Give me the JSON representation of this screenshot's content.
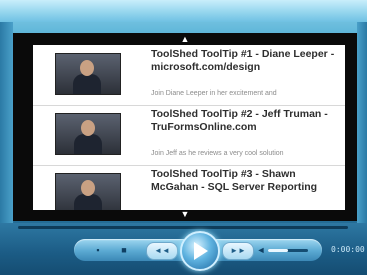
{
  "playlist": {
    "scroll_up_glyph": "▲",
    "scroll_down_glyph": "▼",
    "items": [
      {
        "title": "ToolShed ToolTip #1 - Diane Leeper - microsoft.com/design",
        "description": "Join Diane Leeper in her excitement and",
        "thumbnail_icon": "video-thumbnail"
      },
      {
        "title": "ToolShed ToolTip #2 - Jeff Truman - TruFormsOnline.com",
        "description": "Join Jeff as he reviews a very cool solution",
        "thumbnail_icon": "video-thumbnail"
      },
      {
        "title": "ToolShed ToolTip #3 - Shawn McGahan - SQL Server Reporting",
        "description": "",
        "thumbnail_icon": "video-thumbnail"
      }
    ]
  },
  "controls": {
    "stop_glyph": "■",
    "prev_label": "◄◄",
    "play_icon": "play-icon",
    "next_label": "►►",
    "mute_glyph": "◄",
    "time": "0:00:00",
    "volume_level": 0.5,
    "progress": 0
  },
  "colors": {
    "frame": "#2f7fa9",
    "video_background": "#0a0a0a",
    "list_background": "#ffffff",
    "accent": "#9ee6ff"
  }
}
